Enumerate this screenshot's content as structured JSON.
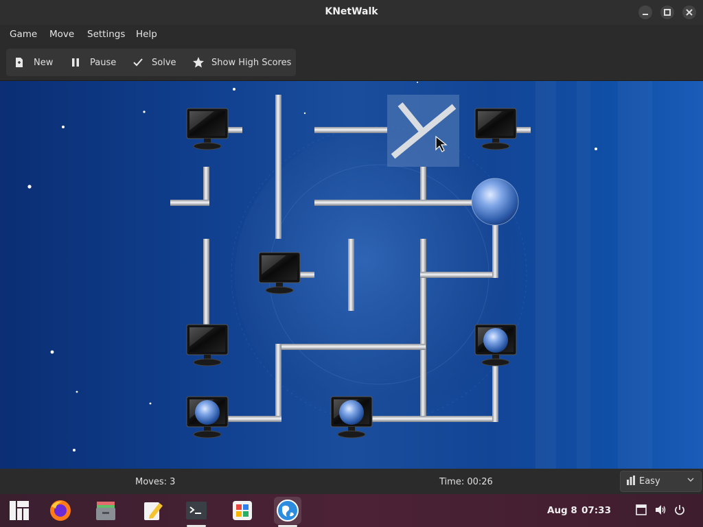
{
  "window": {
    "title": "KNetWalk"
  },
  "menu": {
    "items": [
      "Game",
      "Move",
      "Settings",
      "Help"
    ]
  },
  "toolbar": {
    "new_label": "New",
    "pause_label": "Pause",
    "solve_label": "Solve",
    "high_scores_label": "Show High Scores"
  },
  "status": {
    "moves": "Moves: 3",
    "time": "Time: 00:26",
    "difficulty": "Easy"
  },
  "taskbar": {
    "apps": [
      "manjaro-menu-icon",
      "firefox-icon",
      "files-icon",
      "text-editor-icon",
      "terminal-icon",
      "software-store-icon",
      "knetwalk-icon"
    ],
    "active_app": "knetwalk-icon",
    "date": "Aug 8",
    "time": "07:33"
  },
  "colors": {
    "board_bg": "#10408f",
    "pipe": "#c9ccd2",
    "highlight_cell": "#4d74b0",
    "taskbar": "#4c2236"
  }
}
